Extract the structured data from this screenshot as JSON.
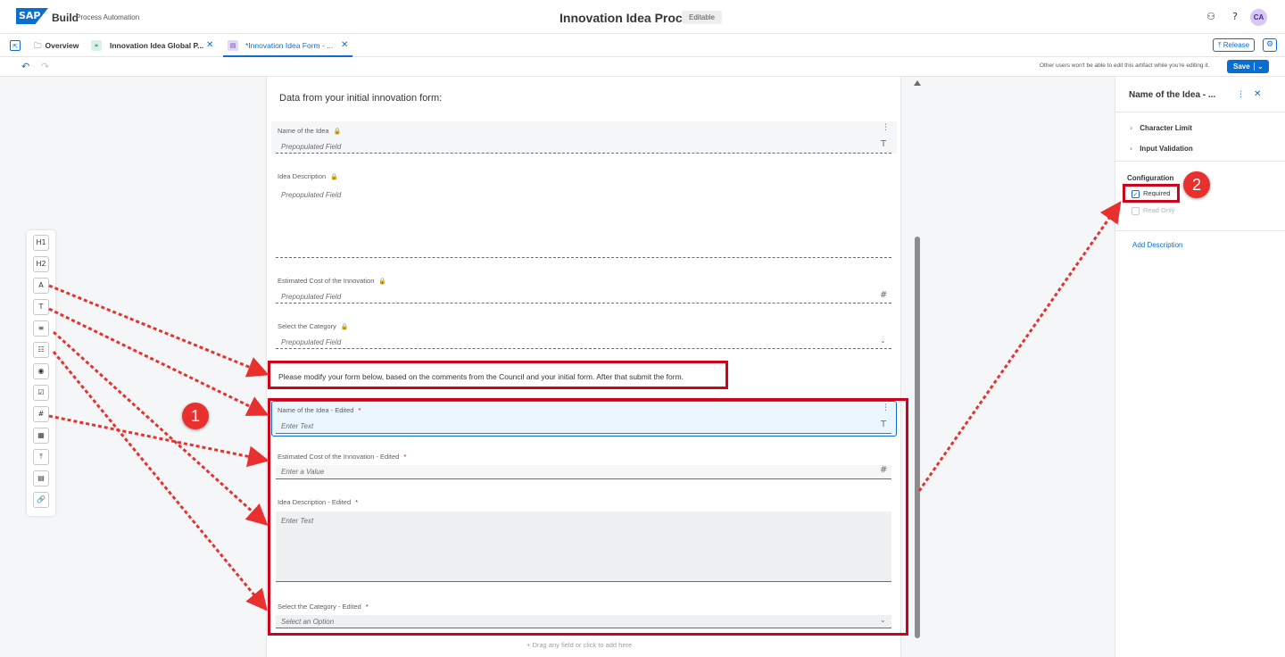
{
  "shell": {
    "logo_text": "SAP",
    "product": "Build",
    "product_sub": "Process Automation",
    "title": "Innovation Idea Process",
    "badge": "Editable",
    "avatar_initials": "CA",
    "icons": [
      "assistant-icon",
      "help-icon"
    ]
  },
  "tabs": {
    "items": [
      {
        "label": "Overview",
        "icon": "folder-icon"
      },
      {
        "label": "Innovation Idea Global P...",
        "icon": "process-icon"
      },
      {
        "label": "*Innovation Idea Form - ...",
        "icon": "form-icon"
      }
    ],
    "release_label": "Release"
  },
  "toolbar": {
    "edit_note": "Other users won't be able to edit this artifact while you're editing it.",
    "save_label": "Save"
  },
  "palette": {
    "items": [
      "H1",
      "H2",
      "A",
      "T",
      "≡",
      "☷",
      "◉",
      "☑",
      "#",
      "▦",
      "⤒",
      "▤",
      "🔗"
    ]
  },
  "form": {
    "heading": "Data from your initial innovation form:",
    "fields_initial": [
      {
        "label": "Name of the Idea",
        "placeholder": "Prepopulated Field"
      },
      {
        "label": "Idea Description",
        "placeholder": "Prepopulated Field"
      },
      {
        "label": "Estimated Cost of the Innovation",
        "placeholder": "Prepopulated Field"
      },
      {
        "label": "Select the Category",
        "placeholder": "Prepopulated Field"
      }
    ],
    "instruction": "Please modify your form below, based on the comments from the Council and your initial form. After that submit the form.",
    "fields_edited": [
      {
        "label": "Name of the Idea - Edited",
        "placeholder": "Enter Text"
      },
      {
        "label": "Estimated Cost of the Innovation - Edited",
        "placeholder": "Enter a Value"
      },
      {
        "label": "Idea Description - Edited",
        "placeholder": "Enter Text"
      },
      {
        "label": "Select the Category - Edited",
        "placeholder": "Select an Option"
      }
    ],
    "required_marker": "*",
    "drag_hint": "+ Drag any field or click to add here"
  },
  "callouts": [
    "1",
    "2"
  ],
  "panel": {
    "title": "Name of the Idea - ...",
    "sections": [
      "Character Limit",
      "Input Validation"
    ],
    "config_label": "Configuration",
    "required_label": "Required",
    "readonly_label": "Read Only",
    "required_checked": true,
    "readonly_checked": false,
    "add_description": "Add Description"
  },
  "colors": {
    "accent": "#0a6ed1",
    "annotation_red": "#d0021b",
    "callout_red": "#e8312f"
  }
}
